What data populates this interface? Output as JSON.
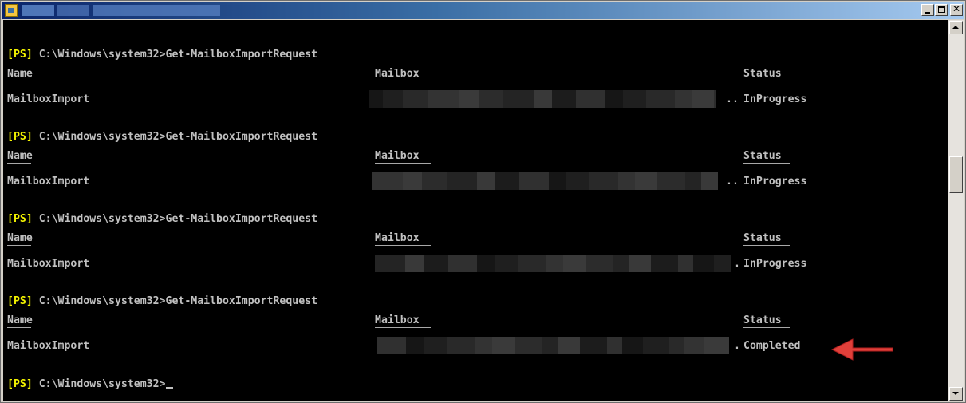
{
  "window": {
    "title": "",
    "controls": {
      "minimize": "minimize",
      "maximize": "maximize",
      "close": "✕"
    }
  },
  "console": {
    "prompt_tag": "[PS]",
    "prompt_path": " C:\\Windows\\system32>",
    "command": "Get-MailboxImportRequest",
    "columns": {
      "name": "Name",
      "mailbox": "Mailbox",
      "status": "Status"
    },
    "blocks": [
      {
        "name": "MailboxImport",
        "mailbox_suffix": "..",
        "status": "InProgress"
      },
      {
        "name": "MailboxImport",
        "mailbox_suffix": "..",
        "status": "InProgress"
      },
      {
        "name": "MailboxImport",
        "mailbox_suffix": ".",
        "status": "InProgress"
      },
      {
        "name": "MailboxImport",
        "mailbox_suffix": ".",
        "status": "Completed"
      }
    ]
  },
  "annotation": {
    "arrow_color": "#e0403a",
    "icon": "arrow-left-icon"
  },
  "colors": {
    "prompt_tag": "#f4f400",
    "text": "#c0c0c0",
    "background": "#000000"
  }
}
